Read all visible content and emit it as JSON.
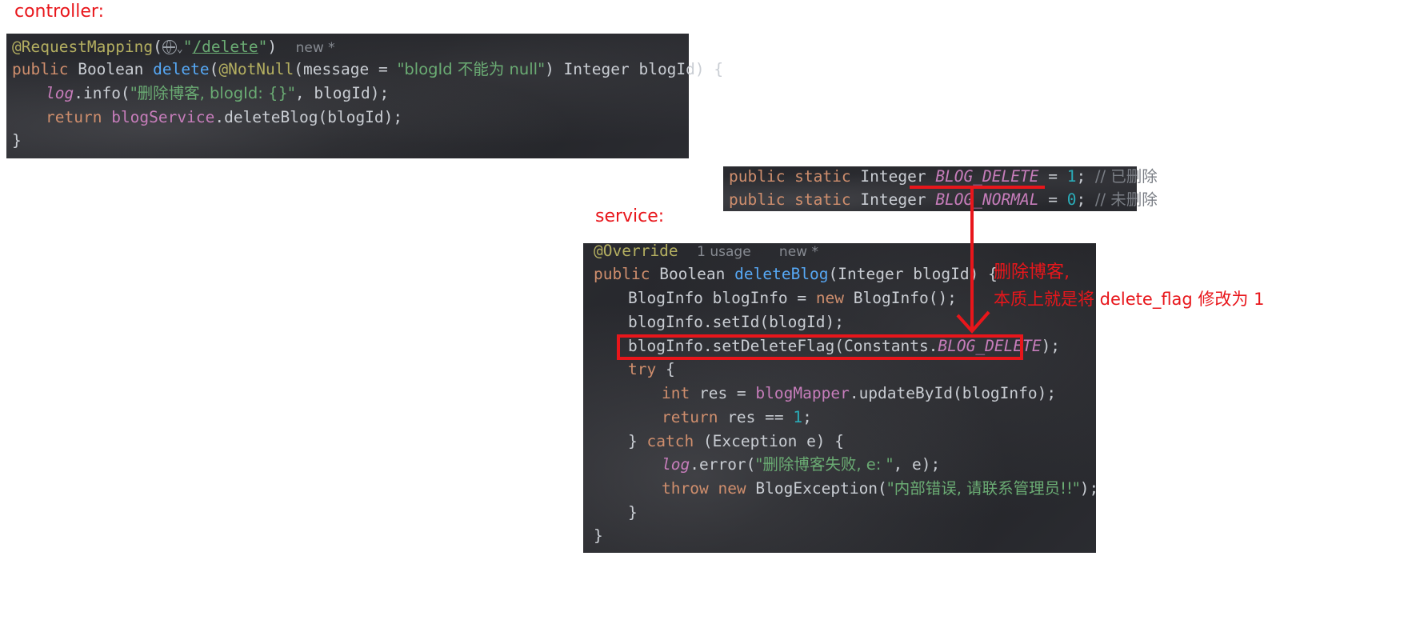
{
  "labels": {
    "controller": "controller:",
    "service": "service:"
  },
  "controller": {
    "mapping_annotation": "@RequestMapping",
    "mapping_path": "/delete",
    "hint_new": "new *",
    "l2_kw": "public",
    "l2_type": "Boolean",
    "l2_fn": "delete",
    "l2_ann": "@NotNull",
    "l2_param": "message",
    "l2_str": "\"blogId 不能为 null\"",
    "l2_rest": ") Integer blogId) {",
    "l3_log": "log",
    "l3_call": ".info(",
    "l3_str": "\"删除博客, blogId: {}\"",
    "l3_rest": ", blogId);",
    "l4_kw": "return",
    "l4_obj": "blogService",
    "l4_rest": ".deleteBlog(blogId);",
    "l5": "}"
  },
  "constants": {
    "line1": {
      "mods": "public static",
      "type": "Integer",
      "name": "BLOG_DELETE",
      "value": "1",
      "comment": "// 已删除"
    },
    "line2": {
      "mods": "public static",
      "type": "Integer",
      "name": "BLOG_NORMAL",
      "value": "0",
      "comment": "// 未删除"
    }
  },
  "service": {
    "override": "@Override",
    "hint_usage": "1 usage",
    "hint_new": "new *",
    "l2_kw": "public",
    "l2_type": "Boolean",
    "l2_fn": "deleteBlog",
    "l2_rest": "(Integer blogId) {",
    "l3_a": "BlogInfo blogInfo = ",
    "l3_kw": "new",
    "l3_b": " BlogInfo();",
    "l4": "blogInfo.setId(blogId);",
    "l5_a": "blogInfo.setDeleteFlag(Constants.",
    "l5_field": "BLOG_DELETE",
    "l5_b": ");",
    "l6_kw": "try",
    "l6_b": " {",
    "l7_kw": "int",
    "l7_a": " res = ",
    "l7_obj": "blogMapper",
    "l7_b": ".updateById(blogInfo);",
    "l8_kw": "return",
    "l8_a": " res == ",
    "l8_num": "1",
    "l8_b": ";",
    "l9_a": "} ",
    "l9_kw": "catch",
    "l9_b": " (Exception e) {",
    "l10_log": "log",
    "l10_a": ".error(",
    "l10_str": "\"删除博客失败, e: \"",
    "l10_b": ", e);",
    "l11_kw1": "throw",
    "l11_kw2": "new",
    "l11_a": " BlogException(",
    "l11_str": "\"内部错误, 请联系管理员!!\"",
    "l11_b": ");",
    "l12": "}",
    "l13": "}"
  },
  "annotation": {
    "line1": "删除博客,",
    "line2": "本质上就是将 delete_flag 修改为 1"
  },
  "colors": {
    "annotation_red": "#e8161b",
    "code_bg": "#222327",
    "keyword": "#cf8e6d",
    "string": "#6aab73",
    "function": "#56a8f5",
    "field": "#c77dbb",
    "number": "#2aacb8"
  }
}
